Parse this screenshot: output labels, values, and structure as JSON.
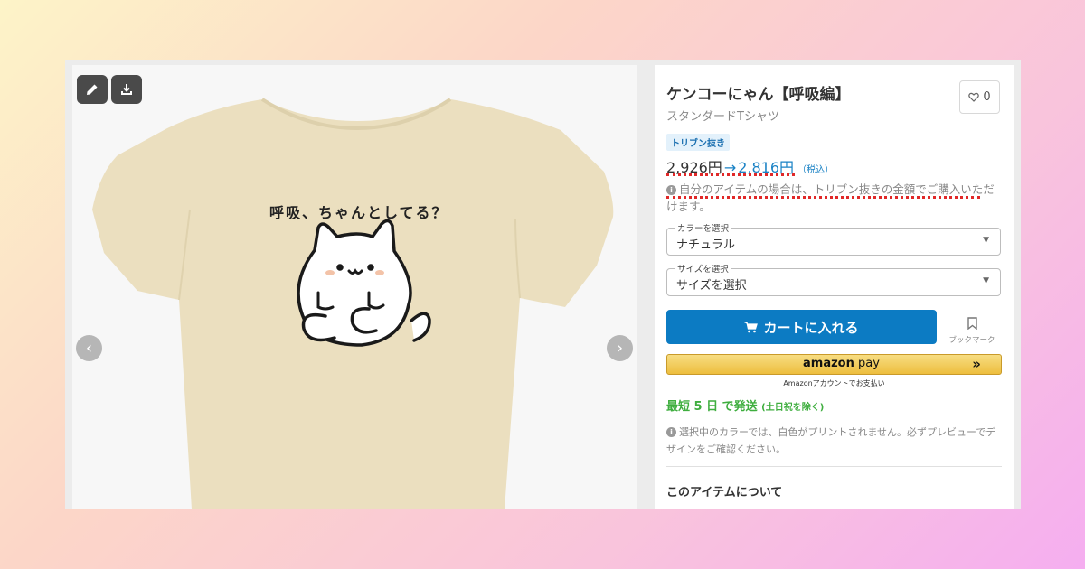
{
  "colors": {
    "background_gradient": [
      "#fdf4c8",
      "#fcd6c8",
      "#f9c4dc",
      "#f5aef0"
    ],
    "shirt": "#ebdfbf",
    "accent_blue": "#0c7bc3",
    "ship_green": "#3fae3f",
    "annotation_red": "#e02828"
  },
  "toolbar": {
    "edit_icon": "pencil-icon",
    "download_icon": "download-icon"
  },
  "preview": {
    "shirt_text": "呼吸、ちゃんとしてる？",
    "prev_arrow": "‹",
    "next_arrow": "›"
  },
  "product": {
    "title": "ケンコーにゃん【呼吸編】",
    "subtitle": "スタンダードTシャツ",
    "favorite_count": "0",
    "badge": "トリブン抜き",
    "price_old": "2,926円",
    "price_arrow": "→",
    "price_new": "2,816円",
    "price_tax": "（税込）",
    "owner_note": "自分のアイテムの場合は、トリブン抜きの金額でご購入いただけます。"
  },
  "color_select": {
    "legend": "カラーを選択",
    "value": "ナチュラル"
  },
  "size_select": {
    "legend": "サイズを選択",
    "value": "サイズを選択"
  },
  "actions": {
    "cart_label": "カートに入れる",
    "bookmark_label": "ブックマーク",
    "amazon_logo_a": "amazon",
    "amazon_logo_b": "pay",
    "amazon_chevrons": "»",
    "amazon_sub": "Amazonアカウントでお支払い"
  },
  "shipping": {
    "main": "最短 5 日 で発送",
    "sub": "(土日祝を除く)"
  },
  "print_note": "選択中のカラーでは、白色がプリントされません。必ずプレビューでデザインをご確認ください。",
  "about_heading": "このアイテムについて"
}
